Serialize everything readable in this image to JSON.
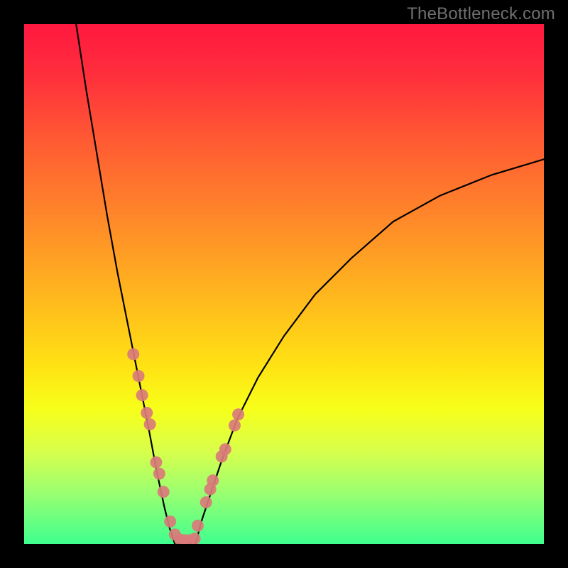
{
  "watermark": "TheBottleneck.com",
  "chart_data": {
    "type": "line",
    "title": "",
    "xlabel": "",
    "ylabel": "",
    "xlim": [
      0,
      100
    ],
    "ylim": [
      0,
      100
    ],
    "grid": false,
    "legend": false,
    "background": "red-yellow-green vertical gradient",
    "series": [
      {
        "name": "left-branch",
        "x": [
          10,
          12,
          14,
          16,
          18,
          20,
          22,
          24,
          25.5,
          27,
          28,
          29
        ],
        "y": [
          100,
          87,
          75,
          63,
          52,
          42,
          32,
          22,
          14,
          7,
          3,
          0
        ]
      },
      {
        "name": "valley",
        "x": [
          29,
          30,
          31,
          32,
          33
        ],
        "y": [
          0,
          0,
          0,
          0,
          0
        ]
      },
      {
        "name": "right-branch",
        "x": [
          33,
          34,
          36,
          38,
          41,
          45,
          50,
          56,
          63,
          71,
          80,
          90,
          100
        ],
        "y": [
          0,
          4,
          10,
          16,
          24,
          32,
          40,
          48,
          55,
          62,
          67,
          71,
          74
        ]
      }
    ],
    "markers": [
      {
        "name": "left-dots",
        "x": [
          21.0,
          22.0,
          22.7,
          23.6,
          24.2,
          25.4,
          26.0,
          26.8,
          28.1,
          29.0,
          30.0,
          30.9
        ],
        "y": [
          36.5,
          32.3,
          28.6,
          25.2,
          23.0,
          15.7,
          13.5,
          10.0,
          4.3,
          1.8,
          0.8,
          0.7
        ]
      },
      {
        "name": "right-dots",
        "x": [
          31.8,
          32.8,
          33.4,
          35.0,
          35.8,
          36.3,
          38.0,
          38.7,
          40.5,
          41.2
        ],
        "y": [
          0.7,
          1.0,
          3.5,
          8.0,
          10.5,
          12.2,
          16.8,
          18.2,
          22.8,
          24.9
        ]
      }
    ]
  },
  "colors": {
    "frame": "#000000",
    "dot": "#d97b7a",
    "curve": "#000000",
    "watermark": "#6f6f6f"
  }
}
